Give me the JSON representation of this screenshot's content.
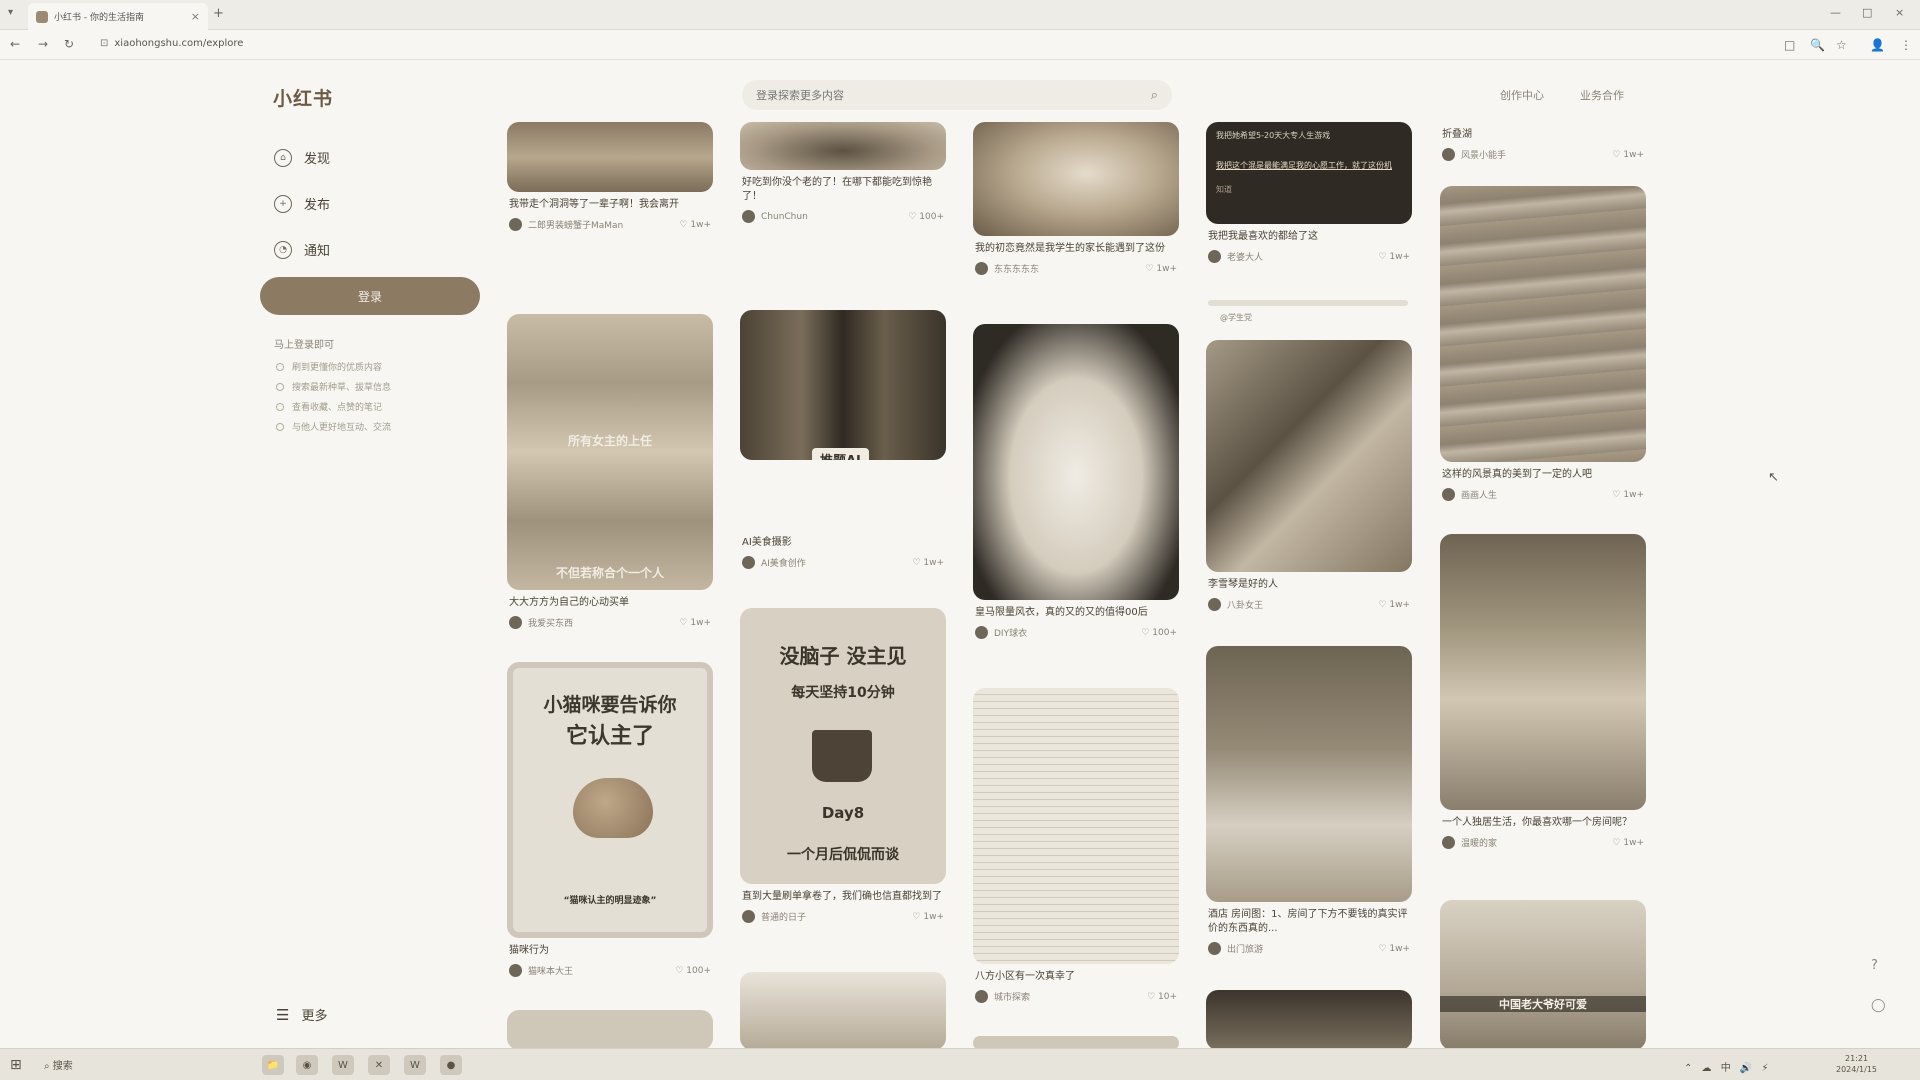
{
  "browser": {
    "tab_title": "小红书 - 你的生活指南",
    "url": "xiaohongshu.com/explore",
    "new_tab": "+",
    "close": "×",
    "controls": [
      "—",
      "□",
      "×"
    ],
    "nav": [
      "←",
      "→",
      "↻"
    ],
    "toolbar_icons": [
      "□",
      "🔍",
      "☆",
      "👤",
      "⋮"
    ]
  },
  "app": {
    "logo": "小红书",
    "search_placeholder": "登录探索更多内容",
    "top_links": [
      "创作中心",
      "业务合作"
    ],
    "sidebar": [
      {
        "label": "发现",
        "icon": "⌂"
      },
      {
        "label": "发布",
        "icon": "+"
      },
      {
        "label": "通知",
        "icon": "◔"
      }
    ],
    "login_label": "登录",
    "hint_title": "马上登录即可",
    "hints": [
      "刷到更懂你的优质内容",
      "搜索最新种草、拔草信息",
      "查看收藏、点赞的笔记",
      "与他人更好地互动、交流"
    ],
    "more_label": "更多"
  },
  "feed": {
    "col1": [
      {
        "title": "我带走个洞洞等了一辈子啊！我会离开",
        "author": "二郎男装螃蟹子MaMan",
        "likes": "1w+"
      },
      {
        "title": "大大方方为自己的心动买单",
        "author": "我爱买东西",
        "likes": "1w+",
        "overlay1": "所有女主的上任",
        "overlay2": "不但若称合个一个人"
      },
      {
        "title": "猫咪行为",
        "author": "猫咪本大王",
        "likes": "100+",
        "poster_line1": "小猫咪要告诉你",
        "poster_line2": "它认主了",
        "poster_caption": "“猫咪认主的明显迹象”"
      }
    ],
    "col2": [
      {
        "title": "好吃到你没个老的了！在哪下都能吃到惊艳了！",
        "author": "ChunChun",
        "likes": "100+"
      },
      {
        "title": "AI美食摄影",
        "author": "AI美食创作",
        "likes": "1w+",
        "badge": "推题AI"
      },
      {
        "title": "直到大量刷单拿卷了，我们确也信直都找到了",
        "author": "普通的日子",
        "likes": "1w+",
        "poster_line1": "没脑子 没主见",
        "poster_line2": "每天坚持10分钟",
        "poster_day": "Day8",
        "poster_line3": "一个月后侃侃而谈"
      }
    ],
    "col3": [
      {
        "title": "我的初恋竟然是我学生的家长能遇到了这份",
        "author": "东东东东东",
        "likes": "1w+"
      },
      {
        "title": "皇马限量风衣，真的又的又的值得00后",
        "author": "DIY球衣",
        "likes": "100+"
      },
      {
        "title": "八方小区有一次真幸了",
        "author": "城市探索",
        "likes": "10+"
      }
    ],
    "col4": [
      {
        "title": "我把我最喜欢的都给了这",
        "author": "老婆大人",
        "likes": "1w+",
        "dark_line1": "我把她希望5-20天大专人生游戏",
        "dark_line2": "我把这个混是最能满足我的心愿工作，就了这份机",
        "dark_line3": "知道"
      },
      {
        "title": "李雪琴是好的人",
        "author": "八卦女王",
        "likes": "1w+",
        "extra": "@学生党"
      },
      {
        "title": "酒店 房间图：1、房间了下方不要钱的真实评价的东西真的...",
        "author": "出门旅游",
        "likes": "1w+"
      }
    ],
    "col5": [
      {
        "title": "折叠湖",
        "author": "风景小能手",
        "likes": "1w+"
      },
      {
        "title": "这样的风景真的美到了一定的人吧",
        "author": "画画人生",
        "likes": "1w+"
      },
      {
        "title": "一个人独居生活，你最喜欢哪一个房间呢？",
        "author": "温暖的家",
        "likes": "1w+"
      },
      {
        "title": "中国老大爷好可爱",
        "author": "",
        "likes": "",
        "overlay": "中国老大爷好可爱"
      }
    ]
  },
  "taskbar": {
    "start": "⊞",
    "search": "搜索",
    "apps": [
      "📁",
      "◉",
      "W",
      "✕",
      "W",
      "●"
    ],
    "tray": "⌃ ☁ 中 🔊 ⚡",
    "time": "21:21",
    "date": "2024/1/15"
  },
  "colors": {
    "accent": "#8c7a63",
    "background": "#f7f6f2"
  }
}
